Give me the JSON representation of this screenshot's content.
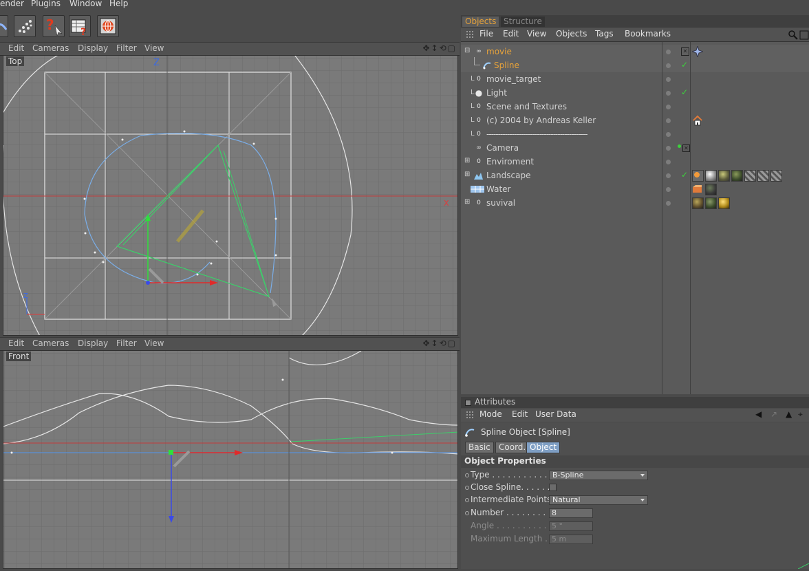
{
  "menubar": {
    "items": [
      "ender",
      "Plugins",
      "Window",
      "Help"
    ]
  },
  "viewport_top": {
    "menu": [
      "Edit",
      "Cameras",
      "Display",
      "Filter",
      "View"
    ],
    "label": "Top",
    "axis_z": "Z",
    "axis_x": "X"
  },
  "viewport_front": {
    "menu": [
      "Edit",
      "Cameras",
      "Display",
      "Filter",
      "View"
    ],
    "label": "Front"
  },
  "object_manager": {
    "tabs": {
      "objects": "Objects",
      "structure": "Structure"
    },
    "menu": [
      "File",
      "Edit",
      "View",
      "Objects",
      "Tags",
      "Bookmarks"
    ],
    "objects": [
      {
        "name": "movie",
        "icon": "infinity-null-icon",
        "color": "#e8a33a"
      },
      {
        "name": "Spline",
        "icon": "spline-icon",
        "color": "#e8a33a"
      },
      {
        "name": "movie_target",
        "icon": "null-object-icon",
        "color": "#d2d2d2"
      },
      {
        "name": "Light",
        "icon": "light-icon",
        "color": "#d2d2d2"
      },
      {
        "name": "Scene and Textures",
        "icon": "null-object-icon",
        "color": "#d2d2d2"
      },
      {
        "name": "(c) 2004 by Andreas Keller",
        "icon": "null-object-icon",
        "color": "#d2d2d2"
      },
      {
        "name": "--------------------------------------------",
        "icon": "null-object-icon",
        "color": "#d2d2d2"
      },
      {
        "name": "Camera",
        "icon": "camera-icon",
        "color": "#d2d2d2"
      },
      {
        "name": "Enviroment",
        "icon": "null-object-icon",
        "color": "#d2d2d2"
      },
      {
        "name": "Landscape",
        "icon": "landscape-icon",
        "color": "#d2d2d2"
      },
      {
        "name": "Water",
        "icon": "plane-icon",
        "color": "#d2d2d2"
      },
      {
        "name": "suvival",
        "icon": "null-object-icon",
        "color": "#d2d2d2"
      }
    ]
  },
  "attributes": {
    "header": "Attributes",
    "menu": [
      "Mode",
      "Edit",
      "User Data"
    ],
    "object_title": "Spline Object [Spline]",
    "tabs": [
      "Basic",
      "Coord.",
      "Object"
    ],
    "section": "Object Properties",
    "props": {
      "type_label": "Type . . . . . . . . . . . . .",
      "type_value": "B-Spline",
      "close_label": "Close Spline. . . . . .",
      "intermediate_label": "Intermediate Points",
      "intermediate_value": "Natural",
      "number_label": "Number . . . . . . . . . .",
      "number_value": "8",
      "angle_label": "Angle . . . . . . . . . . .",
      "angle_value": "5 °",
      "maxlen_label": "Maximum Length . . .",
      "maxlen_value": "5 m"
    }
  },
  "colors": {
    "accent": "#e8a33a",
    "selected_tab": "#7f9fc4",
    "check": "#3cd23c",
    "spline": "#7aaee8",
    "camera_frustum": "#3ccf6a"
  }
}
